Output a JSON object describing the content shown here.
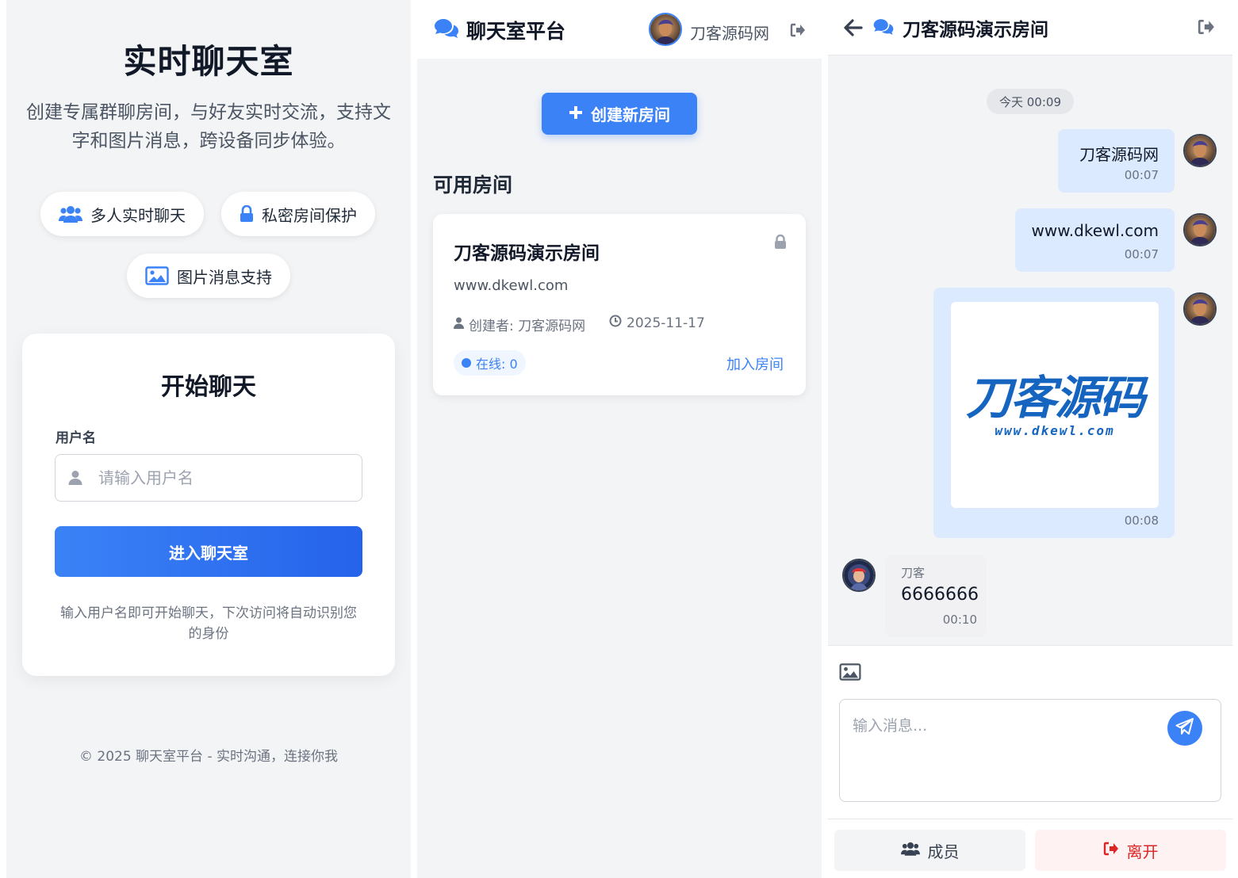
{
  "login": {
    "title": "实时聊天室",
    "description": "创建专属群聊房间，与好友实时交流，支持文字和图片消息，跨设备同步体验。",
    "features": [
      "多人实时聊天",
      "私密房间保护",
      "图片消息支持"
    ],
    "card_title": "开始聊天",
    "username_label": "用户名",
    "username_placeholder": "请输入用户名",
    "enter_button": "进入聊天室",
    "hint": "输入用户名即可开始聊天，下次访问将自动识别您的身份",
    "footer": "© 2025 聊天室平台 - 实时沟通，连接你我"
  },
  "rooms": {
    "app_name": "聊天室平台",
    "username": "刀客源码网",
    "create_button": "创建新房间",
    "section_title": "可用房间",
    "items": [
      {
        "name": "刀客源码演示房间",
        "description": "www.dkewl.com",
        "creator": "创建者: 刀客源码网",
        "date": "2025-11-17",
        "online": "在线: 0",
        "join": "加入房间"
      }
    ]
  },
  "chat": {
    "room_name": "刀客源码演示房间",
    "date_badge": "今天 00:09",
    "messages": [
      {
        "text": "刀客源码网",
        "time": "00:07"
      },
      {
        "text": "www.dkewl.com",
        "time": "00:07"
      },
      {
        "image_title": "刀客源码",
        "image_subtitle": "www.dkewl.com",
        "time": "00:08"
      },
      {
        "sender": "刀客",
        "text": "6666666",
        "time": "00:10"
      }
    ],
    "input_placeholder": "输入消息...",
    "members_button": "成员",
    "leave_button": "离开"
  },
  "colors": {
    "accent": "#3b82f6",
    "danger": "#dc2626",
    "bubble": "#dbeafe"
  }
}
